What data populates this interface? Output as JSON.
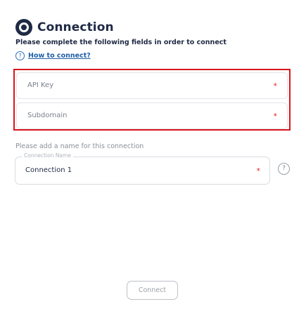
{
  "header": {
    "title": "Connection",
    "icon": "connector-ring-icon"
  },
  "instructions": "Please complete the following fields in order to connect",
  "help_link": {
    "icon": "question-circle-icon",
    "label": "How to connect?"
  },
  "fields": [
    {
      "placeholder": "API Key",
      "required": true,
      "required_marker": "*"
    },
    {
      "placeholder": "Subdomain",
      "required": true,
      "required_marker": "*"
    }
  ],
  "highlight_color": "#d9141c",
  "name_prompt": "Please add a name for this connection",
  "connection_name": {
    "legend": "Connection Name",
    "value": "Connection 1",
    "required_marker": "*"
  },
  "connection_help_icon": "?",
  "connect_button": {
    "label": "Connect",
    "disabled": true
  },
  "colors": {
    "primary": "#1f2a44",
    "link": "#1f5fa8",
    "required": "#e0242a"
  }
}
